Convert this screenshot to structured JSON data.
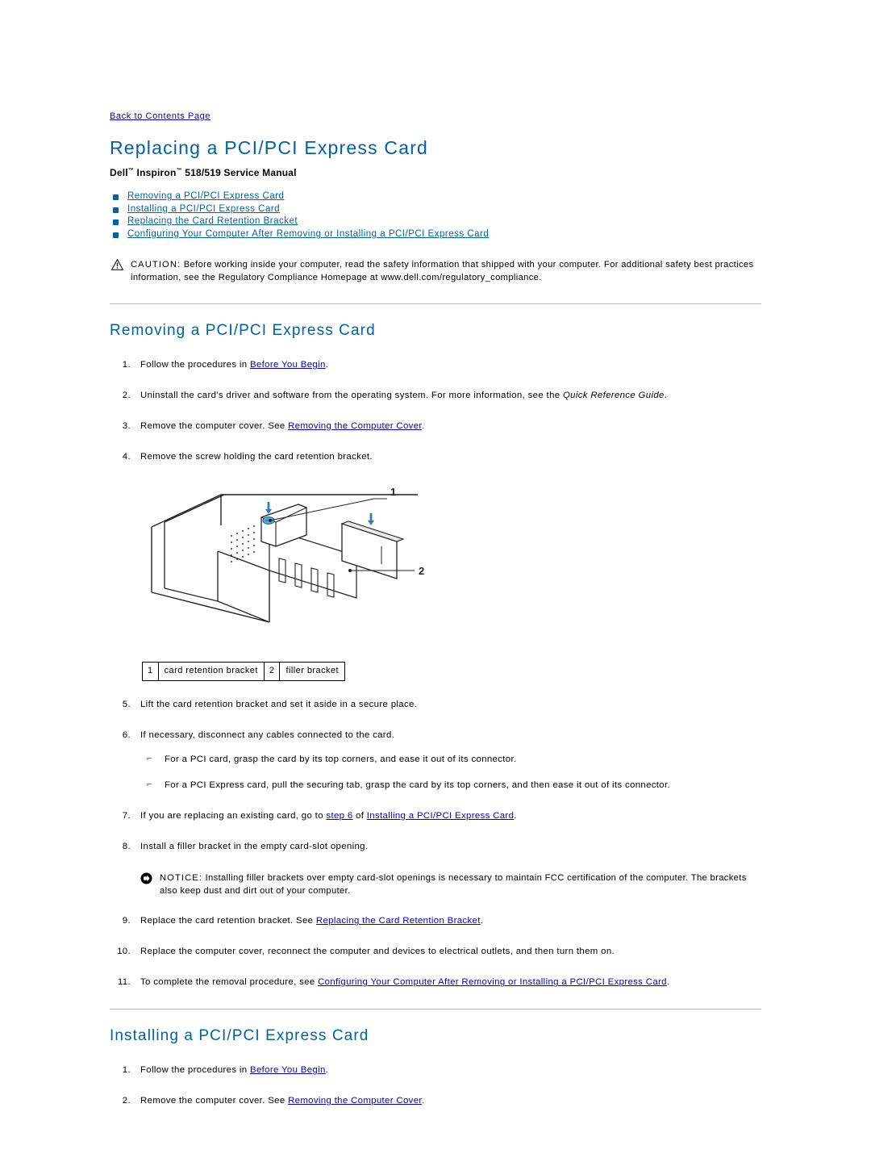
{
  "back_link": "Back to Contents Page",
  "title": "Replacing a PCI/PCI Express Card",
  "subtitle_pre": "Dell",
  "subtitle_tm1": "™",
  "subtitle_mid": " Inspiron",
  "subtitle_tm2": "™",
  "subtitle_post": " 518/519 Service Manual",
  "accent_color": "#0060a8",
  "link_color": "#0000c8",
  "toc": [
    "Removing a PCI/PCI Express Card",
    "Installing a PCI/PCI Express Card",
    "Replacing the Card Retention Bracket",
    "Configuring Your Computer After Removing or Installing a PCI/PCI Express Card"
  ],
  "caution": {
    "keyword": "CAUTION:",
    "text": " Before working inside your computer, read the safety information that shipped with your computer. For additional safety best practices information, see the Regulatory Compliance Homepage at www.dell.com/regulatory_compliance."
  },
  "notice": {
    "keyword": "NOTICE:",
    "text": " Installing filler brackets over empty card-slot openings is necessary to maintain FCC certification of the computer. The brackets also keep dust and dirt out of your computer."
  },
  "sections": [
    {
      "heading": "Removing a PCI/PCI Express Card",
      "steps": [
        {
          "num": "1.",
          "pre": "Follow the procedures in ",
          "link": "Before You Begin",
          "post": "."
        },
        {
          "num": "2.",
          "pre": "Uninstall the card's driver and software from the operating system. For more information, see the ",
          "italic": "Quick Reference Guide",
          "post": "."
        },
        {
          "num": "3.",
          "pre": "Remove the computer cover. See ",
          "link": "Removing the Computer Cover",
          "post": "."
        },
        {
          "num": "4.",
          "pre": "Remove the screw holding the card retention bracket.",
          "post": ""
        },
        {
          "num": "5.",
          "pre": "Lift the card retention bracket and set it aside in a secure place.",
          "post": ""
        },
        {
          "num": "6.",
          "pre": "If necessary, disconnect any cables connected to the card.",
          "post": ""
        },
        {
          "num": "7.",
          "pre": "If you are replacing an existing card, go to ",
          "link": "step 6",
          "mid": " of ",
          "link2": "Installing a PCI/PCI Express Card",
          "post": "."
        },
        {
          "num": "8.",
          "pre": "Install a filler bracket in the empty card-slot opening.",
          "post": ""
        },
        {
          "num": "9.",
          "pre": "Replace the card retention bracket. See ",
          "link": "Replacing the Card Retention Bracket",
          "post": "."
        },
        {
          "num": "10.",
          "pre": "Replace the computer cover, reconnect the computer and devices to electrical outlets, and then turn them on.",
          "post": ""
        },
        {
          "num": "11.",
          "pre": "To complete the removal procedure, see ",
          "link": "Configuring Your Computer After Removing or Installing a PCI/PCI Express Card",
          "post": "."
        }
      ],
      "sublist": [
        "For a PCI card, grasp the card by its top corners, and ease it out of its connector.",
        "For a PCI Express card, pull the securing tab, grasp the card by its top corners, and then ease it out of its connector."
      ],
      "figure_callouts": [
        "1",
        "2"
      ],
      "legend": [
        {
          "index": "1",
          "label": "card retention bracket"
        },
        {
          "index": "2",
          "label": "filler bracket"
        }
      ]
    },
    {
      "heading": "Installing a PCI/PCI Express Card",
      "steps": [
        {
          "num": "1.",
          "pre": "Follow the procedures in ",
          "link": "Before You Begin",
          "post": "."
        },
        {
          "num": "2.",
          "pre": "Remove the computer cover. See ",
          "link": "Removing the Computer Cover",
          "post": "."
        }
      ]
    }
  ]
}
